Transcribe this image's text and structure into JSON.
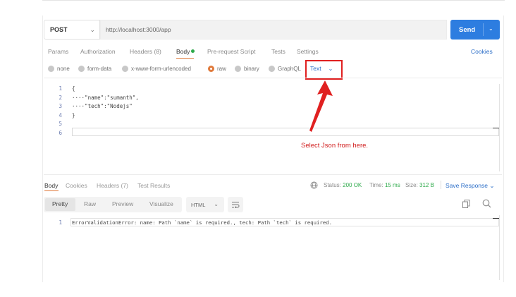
{
  "request": {
    "method": "POST",
    "url": "http://localhost:3000/app",
    "send_label": "Send"
  },
  "request_tabs": [
    {
      "label": "Params"
    },
    {
      "label": "Authorization"
    },
    {
      "label": "Headers (8)"
    },
    {
      "label": "Body"
    },
    {
      "label": "Pre-request Script"
    },
    {
      "label": "Tests"
    },
    {
      "label": "Settings"
    }
  ],
  "cookies_label": "Cookies",
  "body_types": [
    {
      "label": "none"
    },
    {
      "label": "form-data"
    },
    {
      "label": "x-www-form-urlencoded"
    },
    {
      "label": "raw"
    },
    {
      "label": "binary"
    },
    {
      "label": "GraphQL"
    }
  ],
  "raw_format": "Text",
  "editor": {
    "line_numbers": [
      "1",
      "2",
      "3",
      "4",
      "5",
      "6"
    ],
    "lines": [
      "{",
      "····\"name\":\"sumanth\",",
      "····\"tech\":\"Nodejs\"",
      "}",
      "",
      ""
    ]
  },
  "annotation": "Select Json from here.",
  "response": {
    "tabs": [
      {
        "label": "Body"
      },
      {
        "label": "Cookies"
      },
      {
        "label": "Headers (7)"
      },
      {
        "label": "Test Results"
      }
    ],
    "status_label": "Status:",
    "status_value": "200 OK",
    "time_label": "Time:",
    "time_value": "15 ms",
    "size_label": "Size:",
    "size_value": "312 B",
    "save_label": "Save Response",
    "formats": [
      {
        "label": "Pretty"
      },
      {
        "label": "Raw"
      },
      {
        "label": "Preview"
      },
      {
        "label": "Visualize"
      }
    ],
    "language": "HTML",
    "line_number": "1",
    "output": "ErrorValidationError: name: Path `name` is required., tech: Path `tech` is required."
  },
  "colors": {
    "accent": "#e07a3c",
    "send_button": "#2d7de0",
    "link": "#2d6fc8",
    "annotation": "#e02020",
    "status_ok": "#2eaa4b"
  },
  "icons": [
    "chevron-down-icon",
    "globe-icon",
    "copy-icon",
    "search-icon",
    "wrap-lines-icon",
    "arrow-icon"
  ]
}
